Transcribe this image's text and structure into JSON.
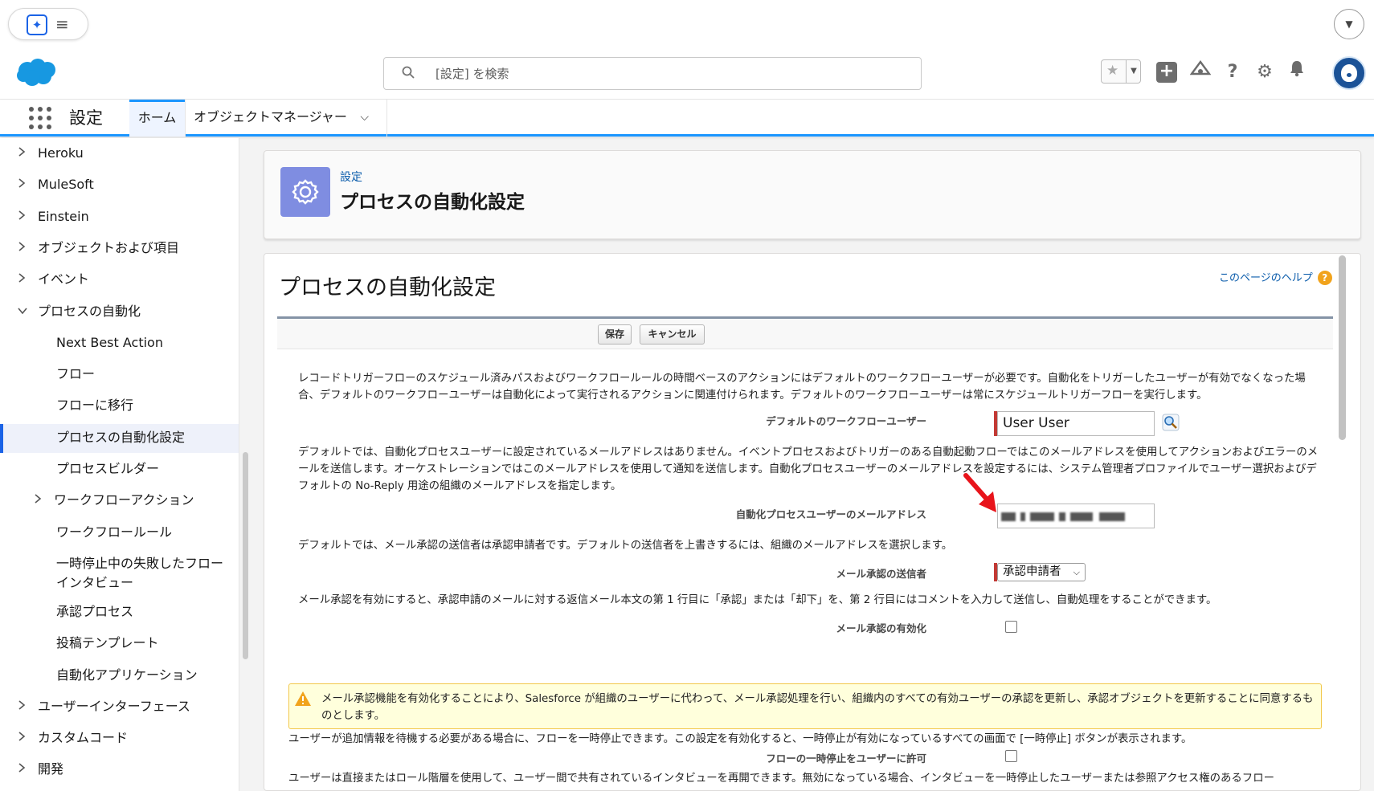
{
  "header": {
    "search_placeholder": "[設定] を検索"
  },
  "nav": {
    "app_name": "設定",
    "tab_home": "ホーム",
    "tab_object_manager": "オブジェクトマネージャー"
  },
  "sidebar": {
    "items": [
      {
        "label": "Heroku",
        "indent": 0,
        "caret": "right"
      },
      {
        "label": "MuleSoft",
        "indent": 0,
        "caret": "right"
      },
      {
        "label": "Einstein",
        "indent": 0,
        "caret": "right"
      },
      {
        "label": "オブジェクトおよび項目",
        "indent": 0,
        "caret": "right"
      },
      {
        "label": "イベント",
        "indent": 0,
        "caret": "right"
      },
      {
        "label": "プロセスの自動化",
        "indent": 0,
        "caret": "down"
      },
      {
        "label": "Next Best Action",
        "indent": 1,
        "caret": ""
      },
      {
        "label": "フロー",
        "indent": 1,
        "caret": ""
      },
      {
        "label": "フローに移行",
        "indent": 1,
        "caret": ""
      },
      {
        "label": "プロセスの自動化設定",
        "indent": 1,
        "caret": "",
        "active": true
      },
      {
        "label": "プロセスビルダー",
        "indent": 1,
        "caret": ""
      },
      {
        "label": "ワークフローアクション",
        "indent": 1,
        "caret": "right"
      },
      {
        "label": "ワークフロールール",
        "indent": 1,
        "caret": ""
      },
      {
        "label": "一時停止中の失敗したフロー",
        "label2": "インタビュー",
        "indent": 1,
        "caret": ""
      },
      {
        "label": "承認プロセス",
        "indent": 1,
        "caret": ""
      },
      {
        "label": "投稿テンプレート",
        "indent": 1,
        "caret": ""
      },
      {
        "label": "自動化アプリケーション",
        "indent": 1,
        "caret": ""
      },
      {
        "label": "ユーザーインターフェース",
        "indent": 0,
        "caret": "right"
      },
      {
        "label": "カスタムコード",
        "indent": 0,
        "caret": "right"
      },
      {
        "label": "開発",
        "indent": 0,
        "caret": "right"
      }
    ]
  },
  "page_header": {
    "breadcrumb": "設定",
    "title": "プロセスの自動化設定"
  },
  "content": {
    "title": "プロセスの自動化設定",
    "help_link": "このページのヘルプ",
    "save_label": "保存",
    "cancel_label": "キャンセル",
    "para1": "レコードトリガーフローのスケジュール済みパスおよびワークフロールールの時間ベースのアクションにはデフォルトのワークフローユーザーが必要です。自動化をトリガーしたユーザーが有効でなくなった場合、デフォルトのワークフローユーザーは自動化によって実行されるアクションに関連付けられます。デフォルトのワークフローユーザーは常にスケジュールトリガーフローを実行します。",
    "default_user_label": "デフォルトのワークフローユーザー",
    "default_user_value": "User User",
    "para2": "デフォルトでは、自動化プロセスユーザーに設定されているメールアドレスはありません。イベントプロセスおよびトリガーのある自動起動フローではこのメールアドレスを使用してアクションおよびエラーのメールを送信します。オーケストレーションではこのメールアドレスを使用して通知を送信します。自動化プロセスユーザーのメールアドレスを設定するには、システム管理者プロファイルでユーザー選択およびデフォルトの No-Reply 用途の組織のメールアドレスを指定します。",
    "email_label": "自動化プロセスユーザーのメールアドレス",
    "para3": "デフォルトでは、メール承認の送信者は承認申請者です。デフォルトの送信者を上書きするには、組織のメールアドレスを選択します。",
    "sender_label": "メール承認の送信者",
    "sender_value": "承認申請者",
    "para4": "メール承認を有効にすると、承認申請のメールに対する返信メール本文の第 1 行目に「承認」または「却下」を、第 2 行目にはコメントを入力して送信し、自動処理をすることができます。",
    "enable_label": "メール承認の有効化",
    "warning": "メール承認機能を有効化することにより、Salesforce が組織のユーザーに代わって、メール承認処理を行い、組織内のすべての有効ユーザーの承認を更新し、承認オブジェクトを更新することに同意するものとします。",
    "para5": "ユーザーが追加情報を待機する必要がある場合に、フローを一時停止できます。この設定を有効化すると、一時停止が有効になっているすべての画面で [一時停止] ボタンが表示されます。",
    "pause_label": "フローの一時停止をユーザーに許可",
    "para6": "ユーザーは直接またはロール階層を使用して、ユーザー間で共有されているインタビューを再開できます。無効になっている場合、インタビューを一時停止したユーザーまたは参照アクセス権のあるフロー"
  },
  "colors": {
    "brand_blue": "#1b96ff",
    "link": "#0b5cab",
    "required": "#c23934",
    "warning_bg": "#ffffdc",
    "arrow": "#e8141b"
  }
}
